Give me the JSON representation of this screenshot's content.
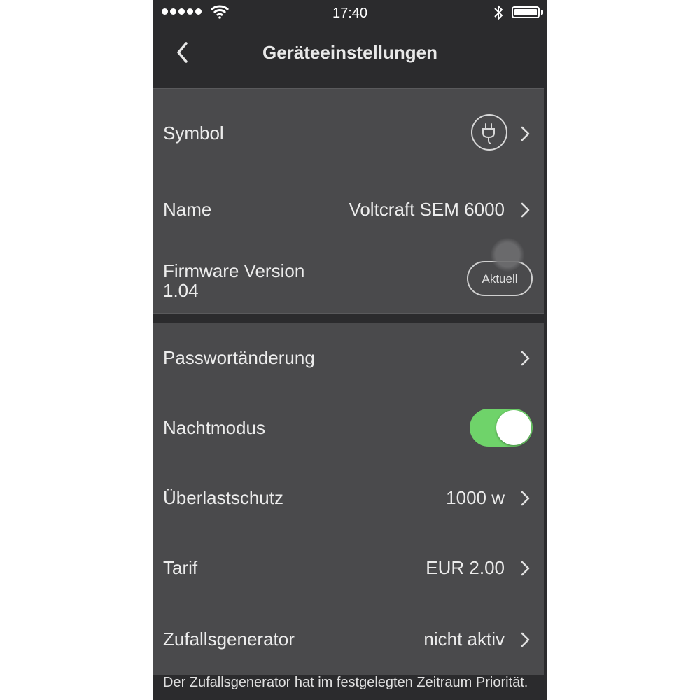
{
  "status_bar": {
    "time": "17:40",
    "signal_dots": 5,
    "icons": [
      "wifi-icon",
      "bluetooth-icon",
      "battery-icon"
    ],
    "battery_level": 1.0
  },
  "nav": {
    "back_icon": "chevron-left-icon",
    "title": "Geräteeinstellungen"
  },
  "group1": {
    "symbol": {
      "label": "Symbol",
      "icon": "plug-icon"
    },
    "name": {
      "label": "Name",
      "value": "Voltcraft SEM 6000"
    },
    "firmware": {
      "label": "Firmware Version",
      "version": "1.04",
      "button": "Aktuell"
    }
  },
  "group2": {
    "password": {
      "label": "Passwortänderung"
    },
    "night_mode": {
      "label": "Nachtmodus",
      "enabled": true
    },
    "overload": {
      "label": "Überlastschutz",
      "value": "1000 w"
    },
    "tariff": {
      "label": "Tarif",
      "value": "EUR 2.00"
    },
    "random": {
      "label": "Zufallsgenerator",
      "value": "nicht aktiv"
    }
  },
  "footer_note": "Der Zufallsgenerator hat im festgelegten Zeitraum Priorität.",
  "colors": {
    "background": "#2b2b2d",
    "cell": "#4a4a4c",
    "toggle_on": "#6fd36a",
    "text": "#ececec"
  }
}
